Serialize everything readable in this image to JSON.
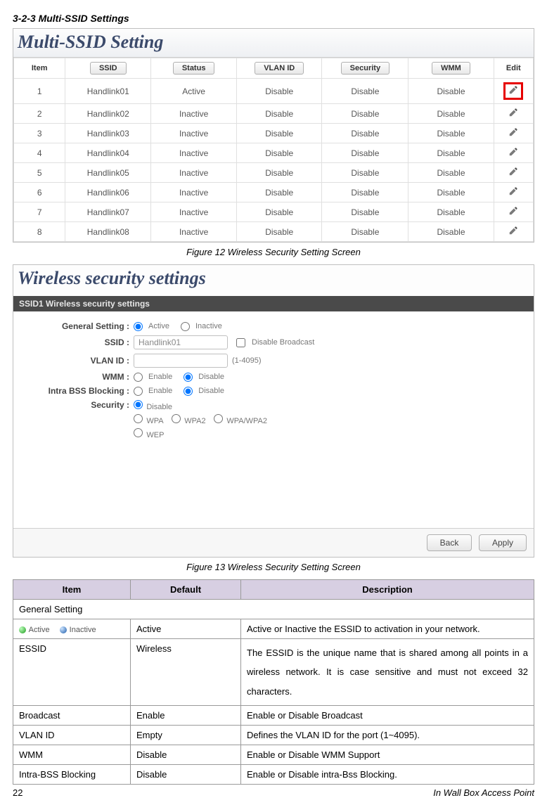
{
  "heading": "3-2-3     Multi-SSID Settings",
  "panel1": {
    "title": "Multi-SSID Setting",
    "headers": {
      "item": "Item",
      "ssid": "SSID",
      "status": "Status",
      "vlan": "VLAN ID",
      "security": "Security",
      "wmm": "WMM",
      "edit": "Edit"
    },
    "rows": [
      {
        "item": "1",
        "ssid": "Handlink01",
        "status": "Active",
        "vlan": "Disable",
        "security": "Disable",
        "wmm": "Disable",
        "highlight": true
      },
      {
        "item": "2",
        "ssid": "Handlink02",
        "status": "Inactive",
        "vlan": "Disable",
        "security": "Disable",
        "wmm": "Disable",
        "highlight": false
      },
      {
        "item": "3",
        "ssid": "Handlink03",
        "status": "Inactive",
        "vlan": "Disable",
        "security": "Disable",
        "wmm": "Disable",
        "highlight": false
      },
      {
        "item": "4",
        "ssid": "Handlink04",
        "status": "Inactive",
        "vlan": "Disable",
        "security": "Disable",
        "wmm": "Disable",
        "highlight": false
      },
      {
        "item": "5",
        "ssid": "Handlink05",
        "status": "Inactive",
        "vlan": "Disable",
        "security": "Disable",
        "wmm": "Disable",
        "highlight": false
      },
      {
        "item": "6",
        "ssid": "Handlink06",
        "status": "Inactive",
        "vlan": "Disable",
        "security": "Disable",
        "wmm": "Disable",
        "highlight": false
      },
      {
        "item": "7",
        "ssid": "Handlink07",
        "status": "Inactive",
        "vlan": "Disable",
        "security": "Disable",
        "wmm": "Disable",
        "highlight": false
      },
      {
        "item": "8",
        "ssid": "Handlink08",
        "status": "Inactive",
        "vlan": "Disable",
        "security": "Disable",
        "wmm": "Disable",
        "highlight": false
      }
    ]
  },
  "caption1": "Figure 12 Wireless Security Setting Screen",
  "panel2": {
    "title": "Wireless security settings",
    "sub": "SSID1 Wireless security settings",
    "labels": {
      "general": "General Setting :",
      "ssid": "SSID :",
      "vlan": "VLAN ID :",
      "wmm": "WMM :",
      "intra": "Intra BSS Blocking :",
      "security": "Security :"
    },
    "values": {
      "active": "Active",
      "inactive": "Inactive",
      "ssid_val": "Handlink01",
      "ssid_cb": "Disable Broadcast",
      "vlan_hint": "(1-4095)",
      "enable": "Enable",
      "disable": "Disable",
      "sec_disable": "Disable",
      "sec_wpa": "WPA",
      "sec_wpa2": "WPA2",
      "sec_wpawpa2": "WPA/WPA2",
      "sec_wep": "WEP"
    },
    "buttons": {
      "back": "Back",
      "apply": "Apply"
    }
  },
  "caption2": "Figure 13 Wireless Security Setting Screen",
  "desc_table": {
    "headers": {
      "item": "Item",
      "default": "Default",
      "desc": "Description"
    },
    "general_label": "General Setting",
    "legend": {
      "active": "Active",
      "inactive": "Inactive"
    },
    "rows": [
      {
        "item_is_image": true,
        "default": "Active",
        "desc": "Active or Inactive the ESSID to activation in your network."
      },
      {
        "item": "ESSID",
        "default": "Wireless",
        "desc": "The ESSID is the unique name that is shared among all points in a wireless network. It is case sensitive and must not exceed 32 characters."
      },
      {
        "item": "Broadcast",
        "default": "Enable",
        "desc": "Enable or Disable Broadcast"
      },
      {
        "item": "VLAN ID",
        "default": "Empty",
        "desc": "Defines the VLAN ID for the port (1~4095)."
      },
      {
        "item": "WMM",
        "default": "Disable",
        "desc": "Enable or Disable WMM Support"
      },
      {
        "item": "Intra-BSS Blocking",
        "default": "Disable",
        "desc": "Enable or Disable intra-Bss Blocking."
      }
    ]
  },
  "footer": {
    "page": "22",
    "label": "In Wall Box Access Point"
  }
}
